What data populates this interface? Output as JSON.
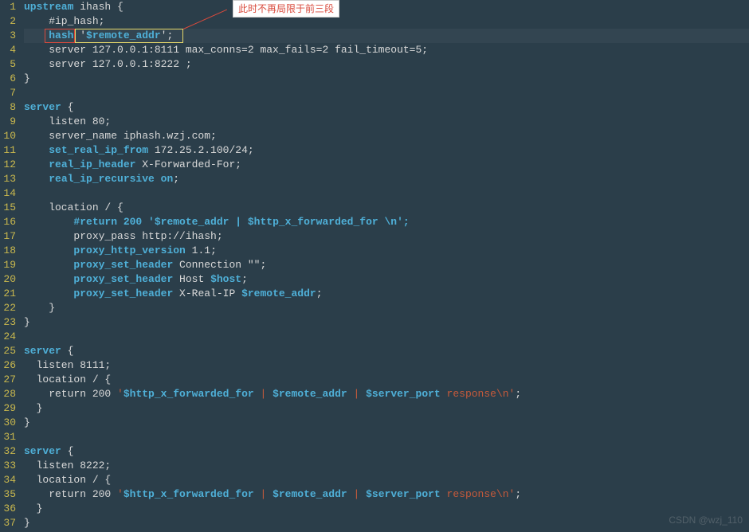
{
  "callout": "此时不再局限于前三段",
  "watermark": "CSDN @wzj_110",
  "lines": {
    "1": {
      "pre": "",
      "kw": "upstream",
      "rest": " ihash {"
    },
    "2": {
      "plain": "    #ip_hash;"
    },
    "3": {
      "pre": "    ",
      "kw": "hash",
      "mid": " '",
      "var": "$remote_addr",
      "post": "';"
    },
    "4": {
      "pre": "    server 127.0.0.1:8111 max_conns=2 max_fails=2 fail_timeout=5;"
    },
    "5": {
      "pre": "    server 127.0.0.1:8222 ;"
    },
    "6": {
      "plain": "}"
    },
    "7": {
      "plain": ""
    },
    "8": {
      "pre": "",
      "kw": "server",
      "rest": " {"
    },
    "9": {
      "pre": "    listen 80;"
    },
    "10": {
      "pre": "    server_name iphash.wzj.com;"
    },
    "11": {
      "pre": "    ",
      "kw": "set_real_ip_from",
      "rest": " 172.25.2.100/24;"
    },
    "12": {
      "pre": "    ",
      "kw": "real_ip_header",
      "rest": " X-Forwarded-For;"
    },
    "13": {
      "pre": "    ",
      "kw": "real_ip_recursive",
      "mid": " ",
      "kw2": "on",
      "post": ";"
    },
    "14": {
      "plain": ""
    },
    "15": {
      "pre": "    location / {"
    },
    "16": {
      "pre": "        ",
      "kw": "#return 200 '$remote_addr | $http_x_forwarded_for \\n';"
    },
    "17": {
      "pre": "        proxy_pass http://ihash;"
    },
    "18": {
      "pre": "        ",
      "kw": "proxy_http_version",
      "rest": " 1.1;"
    },
    "19": {
      "pre": "        ",
      "kw": "proxy_set_header",
      "rest": " Connection \"\";"
    },
    "20": {
      "pre": "        ",
      "kw": "proxy_set_header",
      "mid": " Host ",
      "var": "$host",
      "post": ";"
    },
    "21": {
      "pre": "        ",
      "kw": "proxy_set_header",
      "mid": " X-Real-IP ",
      "var": "$remote_addr",
      "post": ";"
    },
    "22": {
      "plain": "    }"
    },
    "23": {
      "plain": "}"
    },
    "24": {
      "plain": ""
    },
    "25": {
      "pre": "",
      "kw": "server",
      "rest": " {"
    },
    "26": {
      "pre": "  listen 8111;"
    },
    "27": {
      "pre": "  location / {"
    },
    "28": {
      "pre": "    return 200 ",
      "str": "'",
      "var1": "$http_x_forwarded_for",
      "mid1": " | ",
      "var2": "$remote_addr",
      "mid2": " | ",
      "var3": "$server_port",
      "tail": " response\\n'",
      "post": ";"
    },
    "29": {
      "plain": "  }"
    },
    "30": {
      "plain": "}"
    },
    "31": {
      "plain": ""
    },
    "32": {
      "pre": "",
      "kw": "server",
      "rest": " {"
    },
    "33": {
      "pre": "  listen 8222;"
    },
    "34": {
      "pre": "  location / {"
    },
    "35": {
      "pre": "    return 200 ",
      "str": "'",
      "var1": "$http_x_forwarded_for",
      "mid1": " | ",
      "var2": "$remote_addr",
      "mid2": " | ",
      "var3": "$server_port",
      "tail": " response\\n'",
      "post": ";"
    },
    "36": {
      "plain": "  }"
    },
    "37": {
      "plain": "}"
    }
  }
}
